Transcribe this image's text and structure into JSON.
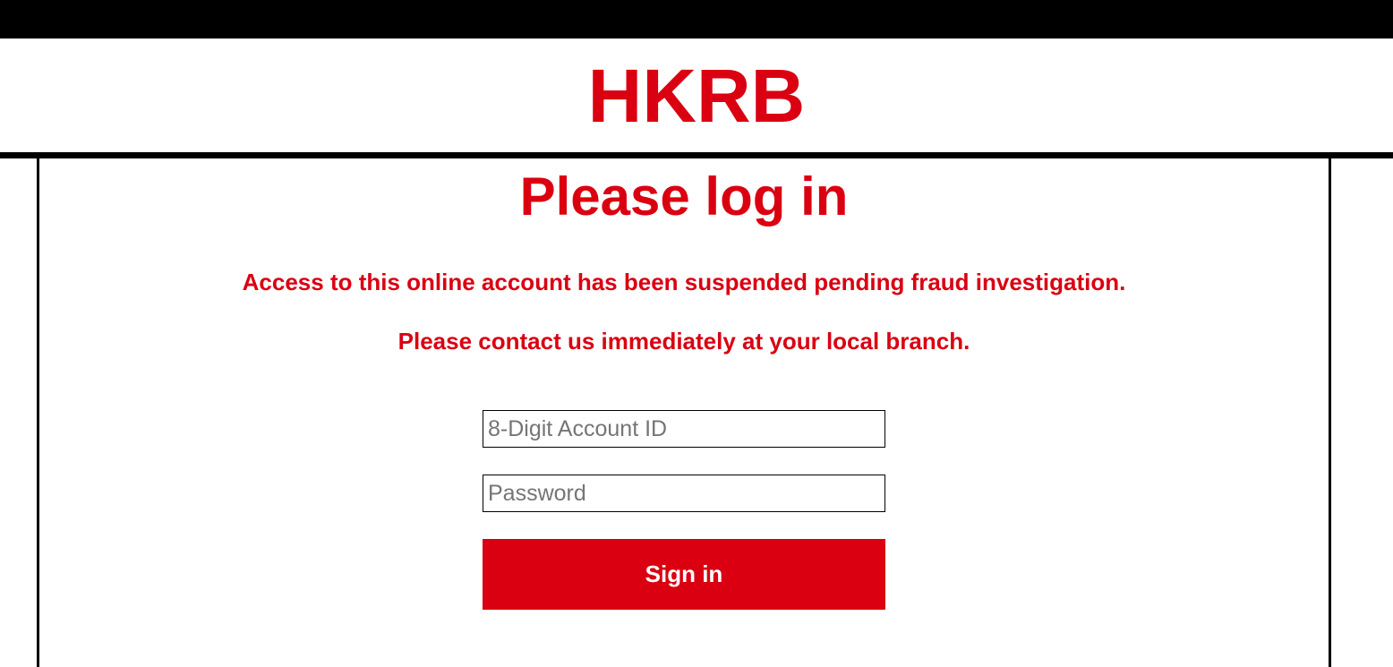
{
  "brand": {
    "logo_text": "HKRB",
    "accent_color": "#da0011"
  },
  "login": {
    "title": "Please log in",
    "messages": [
      "Access to this online account has been suspended pending fraud investigation.",
      "Please contact us immediately at your local branch."
    ],
    "account_id": {
      "value": "",
      "placeholder": "8-Digit Account ID"
    },
    "password": {
      "value": "",
      "placeholder": "Password"
    },
    "sign_in_label": "Sign in"
  }
}
